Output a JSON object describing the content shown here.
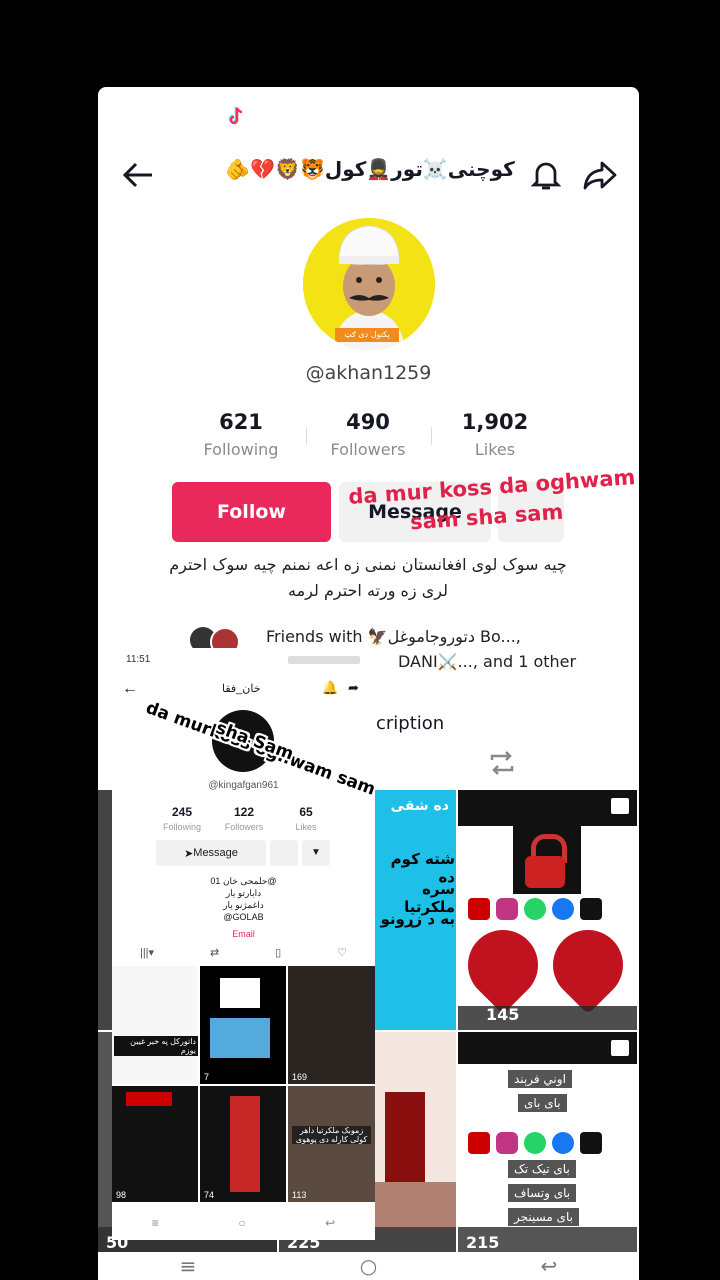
{
  "header": {
    "title": "کوچنی☠️تور💂کول🐯🦁💔🫵",
    "back_icon": "arrow-left-icon",
    "bell_icon": "bell-icon",
    "share_icon": "share-icon"
  },
  "profile": {
    "avatar_badge": "پکتول دی ګټ",
    "handle": "@akhan1259",
    "stats": [
      {
        "value": "621",
        "label": "Following"
      },
      {
        "value": "490",
        "label": "Followers"
      },
      {
        "value": "1,902",
        "label": "Likes"
      }
    ],
    "follow_label": "Follow",
    "message_label": "Message",
    "bio_line1": "چیه سوک لوی افغانستان نمنی زه اعه  نمنم چیه سوک احترم",
    "bio_line2": "لری زه ورته احترم لرمه",
    "friends_line1": "Friends with 🦅دتوروجاموغل Bo...,",
    "friends_line2": "DANI⚔️..., and 1 other",
    "subscription_fragment": "cription"
  },
  "overlay_text": {
    "line1": "da mur koss da oghwam",
    "line2": "sam sha sam",
    "sticker1": "da murkoss oghwam sam",
    "sticker2": "sha Sam"
  },
  "grid": {
    "tile_text_1": "ده شقی",
    "tile_text_2": "شته کوم ده",
    "tile_text_3": "سره ملکرتیا",
    "tile_text_4": "به د زړونو",
    "views_1": "145",
    "menu_1": "اوني فرېند",
    "menu_2": "بای بای",
    "menu_3": "بای تیک تک",
    "menu_4": "بای وتساف",
    "menu_5": "بای مسینجر",
    "bottom_views": [
      "50",
      "225",
      "215"
    ]
  },
  "inner": {
    "status_time": "11:51",
    "title": "خان_فقا",
    "handle": "@kingafgan961",
    "stats": [
      {
        "value": "245",
        "label": "Following"
      },
      {
        "value": "122",
        "label": "Followers"
      },
      {
        "value": "65",
        "label": "Likes"
      }
    ],
    "message_label": "Message",
    "bio1": "01 حلمحی خان@",
    "bio2": "دایارتو یار",
    "bio3": "داغمژنو یار",
    "bio4": "@GOLAB",
    "email": "Email",
    "tile_caption": "داتورکل په خبر غیبن یوزم",
    "tile_caption2": "زموبک ملکرتیا داهر کولی کارله دی پوهوی",
    "views": [
      "7",
      "169",
      "98",
      "74",
      "113"
    ]
  },
  "system_nav": {
    "menu": "≡",
    "home": "○",
    "back": "↩"
  }
}
